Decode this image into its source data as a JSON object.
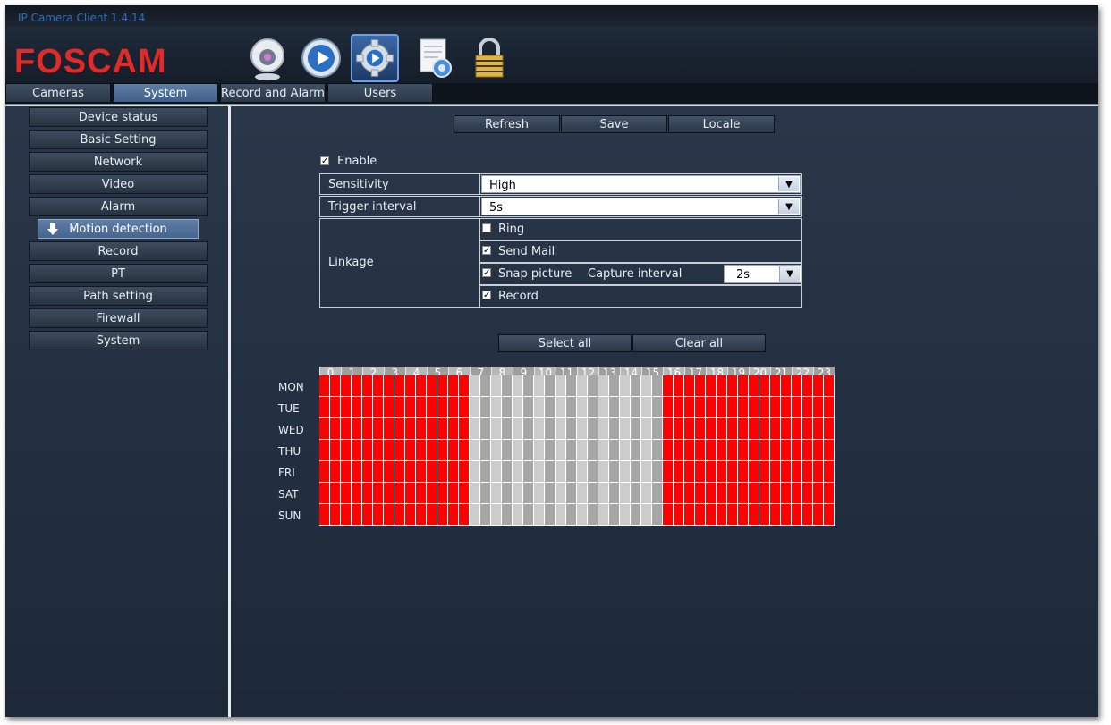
{
  "window": {
    "title": "IP Camera Client 1.4.14"
  },
  "header": {
    "logo_text": "FOSCAM",
    "icons": [
      "webcam-icon",
      "playback-icon",
      "settings-gear-icon",
      "log-document-icon",
      "lock-icon"
    ]
  },
  "tabs": [
    {
      "label": "Cameras",
      "active": false
    },
    {
      "label": "System",
      "active": true
    },
    {
      "label": "Record and Alarm",
      "active": false
    },
    {
      "label": "Users",
      "active": false
    }
  ],
  "sidebar": {
    "items": [
      "Device status",
      "Basic Setting",
      "Network",
      "Video",
      "Alarm"
    ],
    "sub_item": "Motion detection",
    "items_after": [
      "Record",
      "PT",
      "Path setting",
      "Firewall",
      "System"
    ]
  },
  "toolbar": {
    "refresh": "Refresh",
    "save": "Save",
    "locale": "Locale"
  },
  "form": {
    "enable_label": "Enable",
    "enable_checked": true,
    "sensitivity_label": "Sensitivity",
    "sensitivity_value": "High",
    "trigger_label": "Trigger interval",
    "trigger_value": "5s",
    "linkage_label": "Linkage",
    "ring_label": "Ring",
    "ring_checked": false,
    "send_mail_label": "Send Mail",
    "send_mail_checked": true,
    "snap_label": "Snap picture",
    "snap_checked": true,
    "capture_label": "Capture interval",
    "capture_value": "2s",
    "record_label": "Record",
    "record_checked": true
  },
  "schedule": {
    "select_all": "Select all",
    "clear_all": "Clear all",
    "hours": [
      "0",
      "1",
      "2",
      "3",
      "4",
      "5",
      "6",
      "7",
      "8",
      "9",
      "10",
      "11",
      "12",
      "13",
      "14",
      "15",
      "16",
      "17",
      "18",
      "19",
      "20",
      "21",
      "22",
      "23"
    ],
    "days": [
      "MON",
      "TUE",
      "WED",
      "THU",
      "FRI",
      "SAT",
      "SUN"
    ],
    "active_hours": [
      0,
      1,
      2,
      3,
      4,
      5,
      6,
      16,
      17,
      18,
      19,
      20,
      21,
      22,
      23
    ],
    "colors": {
      "active": "#ff0000",
      "inactive_light": "#cccccc",
      "inactive_dark": "#a6a6a6"
    }
  }
}
